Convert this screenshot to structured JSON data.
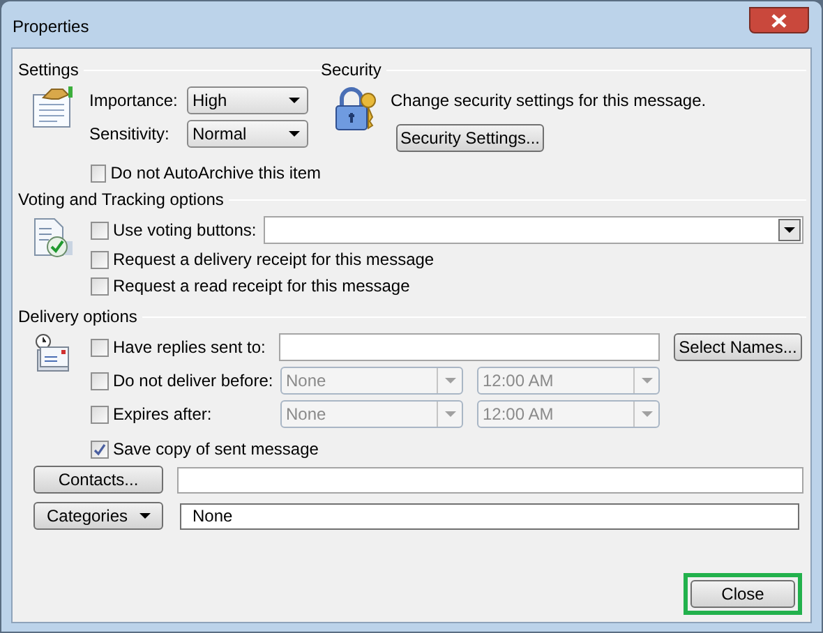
{
  "window": {
    "title": "Properties"
  },
  "settings": {
    "heading": "Settings",
    "importance": {
      "label": "Importance:",
      "value": "High"
    },
    "sensitivity": {
      "label": "Sensitivity:",
      "value": "Normal"
    },
    "auto_archive": {
      "label": "Do not AutoArchive this item",
      "checked": false
    }
  },
  "security": {
    "heading": "Security",
    "text": "Change security settings for this message.",
    "button": "Security Settings..."
  },
  "voting": {
    "heading": "Voting and Tracking options",
    "options": [
      {
        "label": "Use voting buttons:",
        "checked": false
      },
      {
        "label": "Request a delivery receipt for this message",
        "checked": false
      },
      {
        "label": "Request a read receipt for this message",
        "checked": false
      }
    ]
  },
  "delivery": {
    "heading": "Delivery options",
    "replies": {
      "label": "Have replies sent to:",
      "checked": false,
      "button": "Select Names..."
    },
    "schedules": [
      {
        "label": "Do not deliver before:",
        "checked": false,
        "date": "None",
        "time": "12:00 AM",
        "disabled": true
      },
      {
        "label": "Expires after:",
        "checked": false,
        "date": "None",
        "time": "12:00 AM",
        "disabled": true
      }
    ],
    "save_copy": {
      "label": "Save copy of sent message",
      "checked": true
    }
  },
  "contacts": {
    "button": "Contacts..."
  },
  "categories": {
    "button": "Categories",
    "value": "None"
  },
  "close_button": "Close"
}
